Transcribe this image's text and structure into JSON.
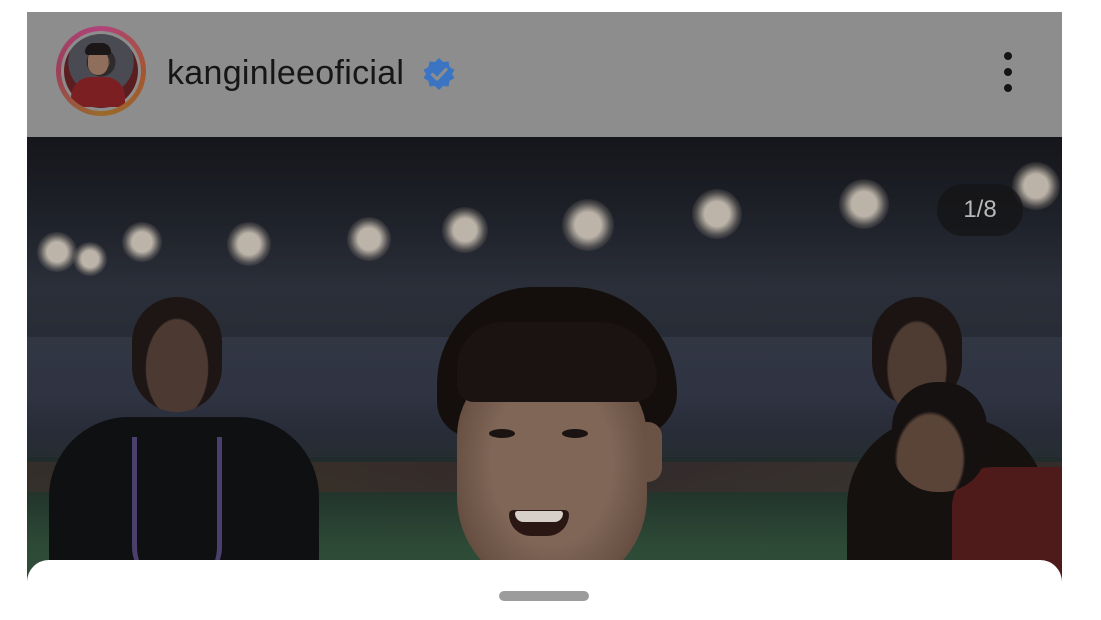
{
  "post": {
    "username": "kanginleeoficial",
    "verified_icon": "verified-badge-icon",
    "more_icon": "more-vertical-icon",
    "media_counter": "1/8"
  },
  "colors": {
    "verified": "#3a74c2",
    "avatar_ring": "#b0437a",
    "header_bg": "#8d8d8d",
    "sheet_bg": "#ffffff"
  }
}
